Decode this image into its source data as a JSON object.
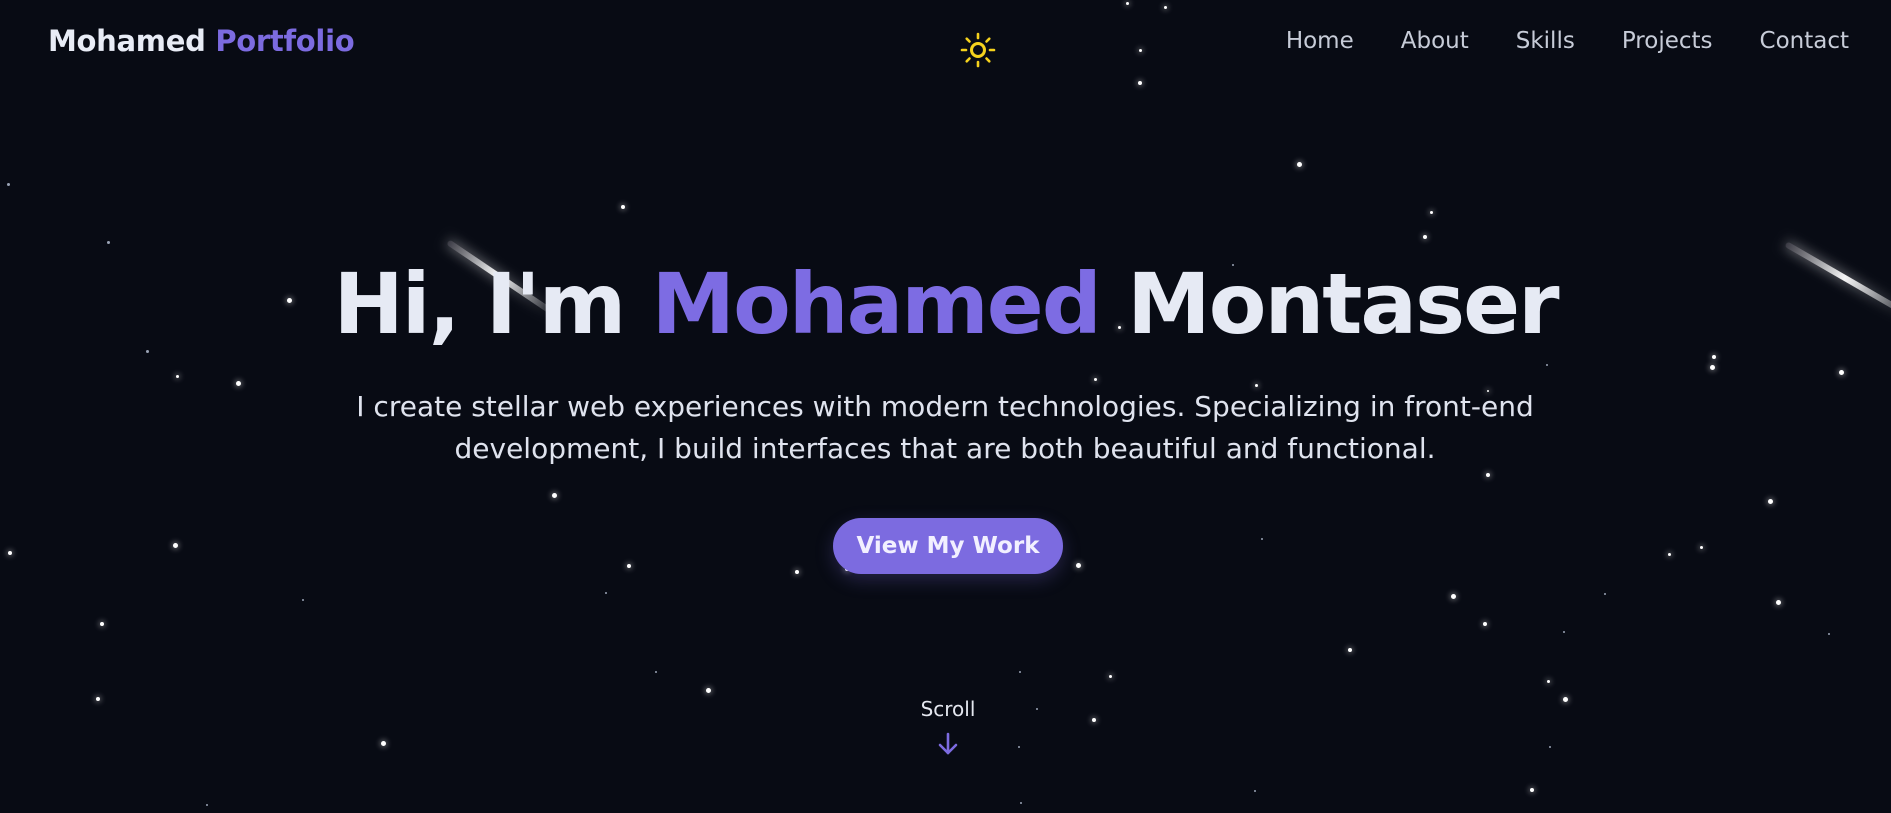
{
  "header": {
    "logo_first": "Mohamed",
    "logo_second": "Portfolio",
    "theme_toggle_icon": "sun-icon",
    "nav": [
      {
        "label": "Home"
      },
      {
        "label": "About"
      },
      {
        "label": "Skills"
      },
      {
        "label": "Projects"
      },
      {
        "label": "Contact"
      }
    ]
  },
  "hero": {
    "greeting": "Hi, I'm",
    "first_name": "Mohamed",
    "last_name": "Montaser",
    "subtitle": "I create stellar web experiences with modern technologies. Specializing in front-end development, I build interfaces that are both beautiful and functional.",
    "cta_label": "View My Work",
    "scroll_label": "Scroll",
    "scroll_icon": "arrow-down-icon"
  },
  "colors": {
    "background": "#080b14",
    "accent": "#7c6be0",
    "text": "#e6eaf4",
    "nav_text": "#c7ccd8",
    "sun": "#f5d21d"
  }
}
